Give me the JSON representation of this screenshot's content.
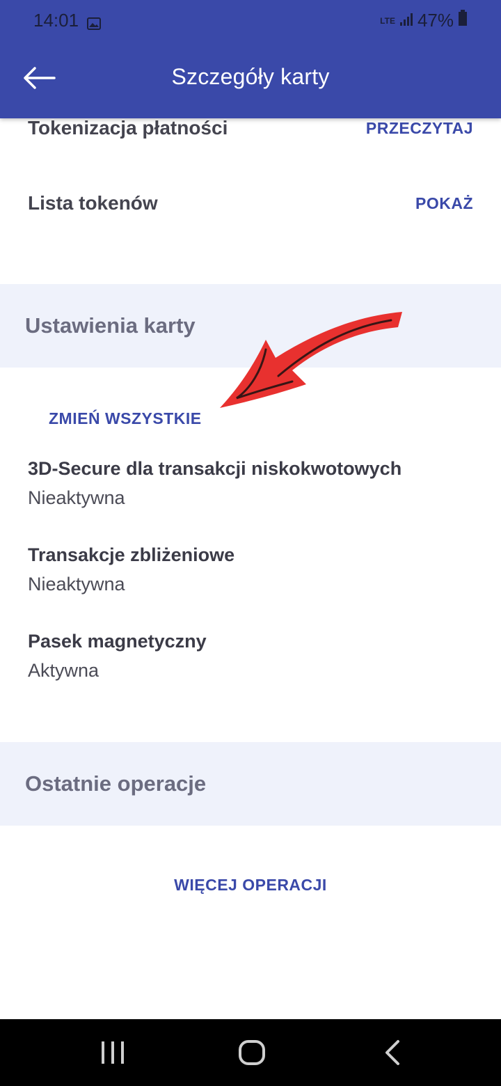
{
  "status_bar": {
    "time": "14:01",
    "network": "LTE",
    "battery": "47%"
  },
  "header": {
    "title": "Szczegóły karty"
  },
  "top_rows": [
    {
      "label": "Tokenizacja płatności",
      "action": "PRZECZYTAJ"
    },
    {
      "label": "Lista tokenów",
      "action": "POKAŻ"
    }
  ],
  "card_settings": {
    "title": "Ustawienia karty",
    "change_all": "ZMIEŃ WSZYSTKIE",
    "items": [
      {
        "name": "3D-Secure dla transakcji niskokwotowych",
        "state": "Nieaktywna"
      },
      {
        "name": "Transakcje zbliżeniowe",
        "state": "Nieaktywna"
      },
      {
        "name": "Pasek magnetyczny",
        "state": "Aktywna"
      }
    ]
  },
  "recent_operations": {
    "title": "Ostatnie operacje",
    "more": "WIĘCEJ OPERACJI"
  },
  "colors": {
    "primary": "#3a49a9",
    "section_bg": "#eff2fb",
    "annotation_arrow": "#e8312f"
  }
}
